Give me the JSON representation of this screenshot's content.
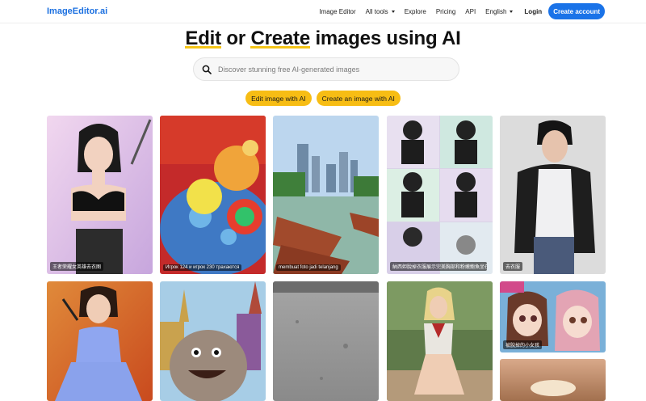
{
  "header": {
    "logo": "ImageEditor.ai",
    "nav": [
      "Image Editor",
      "All tools",
      "Explore",
      "Pricing",
      "API",
      "English"
    ],
    "login": "Login",
    "create_account": "Create account"
  },
  "hero": {
    "title_parts": [
      "Edit",
      " or ",
      "Create",
      " images using AI"
    ]
  },
  "search": {
    "placeholder": "Discover stunning free AI-generated images"
  },
  "cta": {
    "edit": "Edit image with AI",
    "create": "Create an image with AI"
  },
  "gallery": {
    "captions": [
      "王者荣耀女英雄去衣图",
      "Игрок 124 и игрок 230 трахаются",
      "membuat foto jadi telanjang",
      "納西妲脫掉衣服展示完美胸部和粉嫩鮑魚坐在地上張开双腿展示小鮑",
      "去衣服",
      "被脫掉的小女孩"
    ]
  },
  "colors": {
    "brand": "#1a6fe0",
    "primary_button": "#1a73e8",
    "accent_yellow": "#f7bd14"
  }
}
